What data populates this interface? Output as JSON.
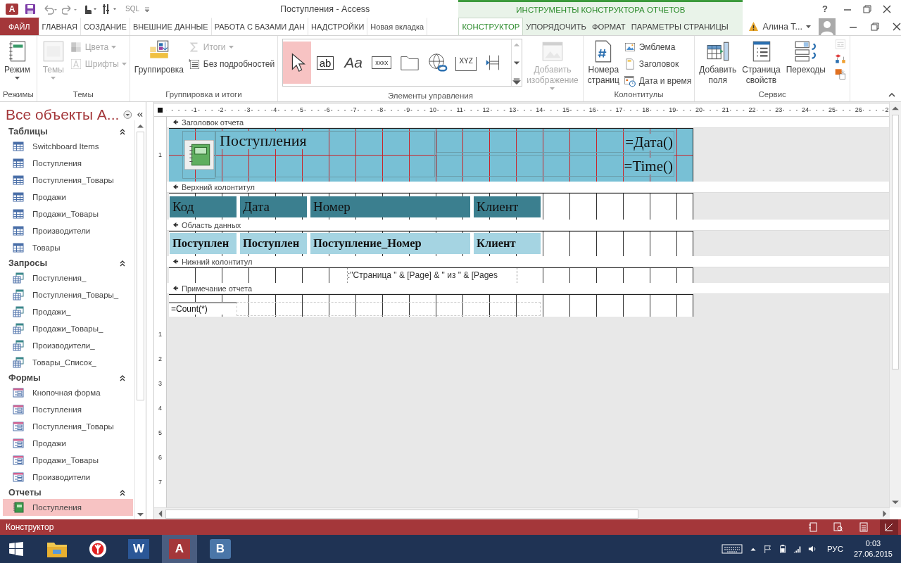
{
  "app_icon": {
    "glyph": "A"
  },
  "quick_access": {
    "sql": "SQL"
  },
  "window": {
    "title": "Поступления - Access",
    "help": "?"
  },
  "contextual": {
    "title": "ИНСТРУМЕНТЫ КОНСТРУКТОРА ОТЧЕТОВ"
  },
  "tabs": [
    {
      "label": "ФАЙЛ",
      "kind": "file",
      "selected": false
    },
    {
      "label": "ГЛАВНАЯ",
      "kind": "normal",
      "selected": false
    },
    {
      "label": "СОЗДАНИЕ",
      "kind": "normal",
      "selected": false
    },
    {
      "label": "ВНЕШНИЕ ДАННЫЕ",
      "kind": "normal",
      "selected": false
    },
    {
      "label": "РАБОТА С БАЗАМИ ДАН",
      "kind": "normal",
      "selected": false
    },
    {
      "label": "НАДСТРОЙКИ",
      "kind": "normal",
      "selected": false
    },
    {
      "label": "Новая вкладка",
      "kind": "normal",
      "selected": false
    },
    {
      "label": "КОНСТРУКТОР",
      "kind": "context",
      "selected": true
    },
    {
      "label": "УПОРЯДОЧИТЬ",
      "kind": "context",
      "selected": false
    },
    {
      "label": "ФОРМАТ",
      "kind": "context",
      "selected": false
    },
    {
      "label": "ПАРАМЕТРЫ СТРАНИЦЫ",
      "kind": "context",
      "selected": false
    }
  ],
  "user": {
    "name": "Алина Т..."
  },
  "ribbon": {
    "groups": [
      {
        "label": "Режимы",
        "commands": [
          {
            "label": "Режим",
            "kind": "large",
            "dropdown": true,
            "disabled": false
          }
        ]
      },
      {
        "label": "Темы",
        "commands": [
          {
            "label": "Темы",
            "kind": "large",
            "dropdown": true,
            "disabled": true
          },
          {
            "label": "Цвета",
            "kind": "small",
            "dropdown": true,
            "disabled": true
          },
          {
            "label": "Шрифты",
            "kind": "small",
            "dropdown": true,
            "disabled": true
          }
        ]
      },
      {
        "label": "Группировка и итоги",
        "commands": [
          {
            "label": "Группировка",
            "kind": "large",
            "dropdown": false,
            "disabled": false
          },
          {
            "label": "Итоги",
            "kind": "small",
            "dropdown": true,
            "disabled": true
          },
          {
            "label": "Без подробностей",
            "kind": "small",
            "dropdown": false,
            "disabled": false
          }
        ]
      },
      {
        "label": "Элементы управления",
        "commands": [
          {
            "kind": "gallery",
            "items": [
              {
                "kind": "pointer",
                "selected": true
              },
              {
                "kind": "textbox",
                "glyph": "ab",
                "selected": false
              },
              {
                "kind": "label",
                "glyph": "Aa",
                "selected": false
              },
              {
                "kind": "button",
                "glyph": "xxxx",
                "selected": false
              },
              {
                "kind": "tab",
                "selected": false
              },
              {
                "kind": "hyperlink",
                "selected": false
              },
              {
                "kind": "group",
                "glyph": "XYZ",
                "selected": false
              },
              {
                "kind": "pagebreak",
                "selected": false
              }
            ]
          },
          {
            "label": "Добавить изображение",
            "kind": "large",
            "dropdown": true,
            "disabled": true
          }
        ]
      },
      {
        "label": "Колонтитулы",
        "commands": [
          {
            "label": "Номера страниц",
            "kind": "large",
            "dropdown": false,
            "disabled": false
          },
          {
            "label": "Эмблема",
            "kind": "small",
            "dropdown": false,
            "disabled": false
          },
          {
            "label": "Заголовок",
            "kind": "small",
            "dropdown": false,
            "disabled": false
          },
          {
            "label": "Дата и время",
            "kind": "small",
            "dropdown": false,
            "disabled": false
          }
        ]
      },
      {
        "label": "Сервис",
        "commands": [
          {
            "label": "Добавить поля",
            "kind": "large",
            "dropdown": false,
            "disabled": false
          },
          {
            "label": "Страница свойств",
            "kind": "large",
            "dropdown": false,
            "disabled": false
          },
          {
            "label": "Переходы",
            "kind": "large",
            "dropdown": false,
            "disabled": false
          },
          {
            "kind": "icons",
            "items": [
              {
                "disabled": true
              },
              {
                "disabled": false
              },
              {
                "disabled": false
              }
            ]
          }
        ]
      }
    ]
  },
  "navigation": {
    "title": "Все объекты A...",
    "groups": [
      {
        "label": "Таблицы",
        "expanded": true,
        "items": [
          {
            "label": "Switchboard Items",
            "kind": "table",
            "selected": false
          },
          {
            "label": "Поступления",
            "kind": "table",
            "selected": false
          },
          {
            "label": "Поступления_Товары",
            "kind": "table",
            "selected": false
          },
          {
            "label": "Продажи",
            "kind": "table",
            "selected": false
          },
          {
            "label": "Продажи_Товары",
            "kind": "table",
            "selected": false
          },
          {
            "label": "Производители",
            "kind": "table",
            "selected": false
          },
          {
            "label": "Товары",
            "kind": "table",
            "selected": false
          }
        ]
      },
      {
        "label": "Запросы",
        "expanded": true,
        "items": [
          {
            "label": "Поступления_",
            "kind": "query",
            "selected": false
          },
          {
            "label": "Поступления_Товары_",
            "kind": "query",
            "selected": false
          },
          {
            "label": "Продажи_",
            "kind": "query",
            "selected": false
          },
          {
            "label": "Продажи_Товары_",
            "kind": "query",
            "selected": false
          },
          {
            "label": "Производители_",
            "kind": "query",
            "selected": false
          },
          {
            "label": "Товары_Список_",
            "kind": "query",
            "selected": false
          }
        ]
      },
      {
        "label": "Формы",
        "expanded": true,
        "items": [
          {
            "label": "Кнопочная форма",
            "kind": "form",
            "selected": false
          },
          {
            "label": "Поступления",
            "kind": "form",
            "selected": false
          },
          {
            "label": "Поступления_Товары",
            "kind": "form",
            "selected": false
          },
          {
            "label": "Продажи",
            "kind": "form",
            "selected": false
          },
          {
            "label": "Продажи_Товары",
            "kind": "form",
            "selected": false
          },
          {
            "label": "Производители",
            "kind": "form",
            "selected": false
          }
        ]
      },
      {
        "label": "Отчеты",
        "expanded": true,
        "items": [
          {
            "label": "Поступления",
            "kind": "report",
            "selected": true
          }
        ]
      }
    ]
  },
  "ruler": {
    "horizontal": [
      "1",
      "2",
      "3",
      "4",
      "5",
      "6",
      "7",
      "8",
      "9",
      "10",
      "11",
      "12",
      "13",
      "14",
      "15",
      "16",
      "17",
      "18",
      "19",
      "20",
      "21",
      "22",
      "23",
      "24",
      "25",
      "26",
      "2"
    ],
    "vertical": [
      "1",
      "2",
      "3",
      "4",
      "5",
      "6",
      "7"
    ]
  },
  "sections": [
    {
      "title": "Заголовок отчета",
      "kind": "report_header",
      "ruler": [
        "1"
      ],
      "controls": [
        {
          "kind": "logo"
        },
        {
          "kind": "title",
          "text": "Поступления"
        },
        {
          "kind": "expr",
          "text": "=Дата()"
        },
        {
          "kind": "expr",
          "text": "=Time()"
        }
      ]
    },
    {
      "title": "Верхний колонтитул",
      "kind": "page_header",
      "controls": [
        {
          "kind": "label",
          "text": "Код"
        },
        {
          "kind": "label",
          "text": "Дата"
        },
        {
          "kind": "label",
          "text": "Номер"
        },
        {
          "kind": "label",
          "text": "Клиент"
        }
      ]
    },
    {
      "title": "Область данных",
      "kind": "detail",
      "controls": [
        {
          "kind": "field",
          "text": "Поступлен"
        },
        {
          "kind": "field",
          "text": "Поступлен"
        },
        {
          "kind": "field",
          "text": "Поступление_Номер"
        },
        {
          "kind": "field",
          "text": "Клиент"
        }
      ]
    },
    {
      "title": "Нижний колонтитул",
      "kind": "page_footer",
      "controls": [
        {
          "kind": "footer_expr",
          "text": ":\"Страница \" & [Page] & \" из \" & [Pages"
        }
      ]
    },
    {
      "title": "Примечание отчета",
      "kind": "report_footer",
      "controls": [
        {
          "kind": "count",
          "text": "=Count(*)"
        }
      ]
    }
  ],
  "status_bar": {
    "text": "Конструктор",
    "views": [
      {
        "kind": "report",
        "selected": false
      },
      {
        "kind": "print",
        "selected": false
      },
      {
        "kind": "layout",
        "selected": false
      },
      {
        "kind": "design",
        "selected": true
      }
    ]
  },
  "taskbar": {
    "apps": [
      {
        "kind": "explorer",
        "selected": false
      },
      {
        "kind": "yandex",
        "selected": false
      },
      {
        "kind": "word",
        "glyph": "W",
        "selected": false
      },
      {
        "kind": "access",
        "glyph": "A",
        "selected": true
      },
      {
        "kind": "vk",
        "glyph": "B",
        "selected": false
      }
    ],
    "language": "РУС",
    "time": "0:03",
    "date": "27.06.2015"
  }
}
